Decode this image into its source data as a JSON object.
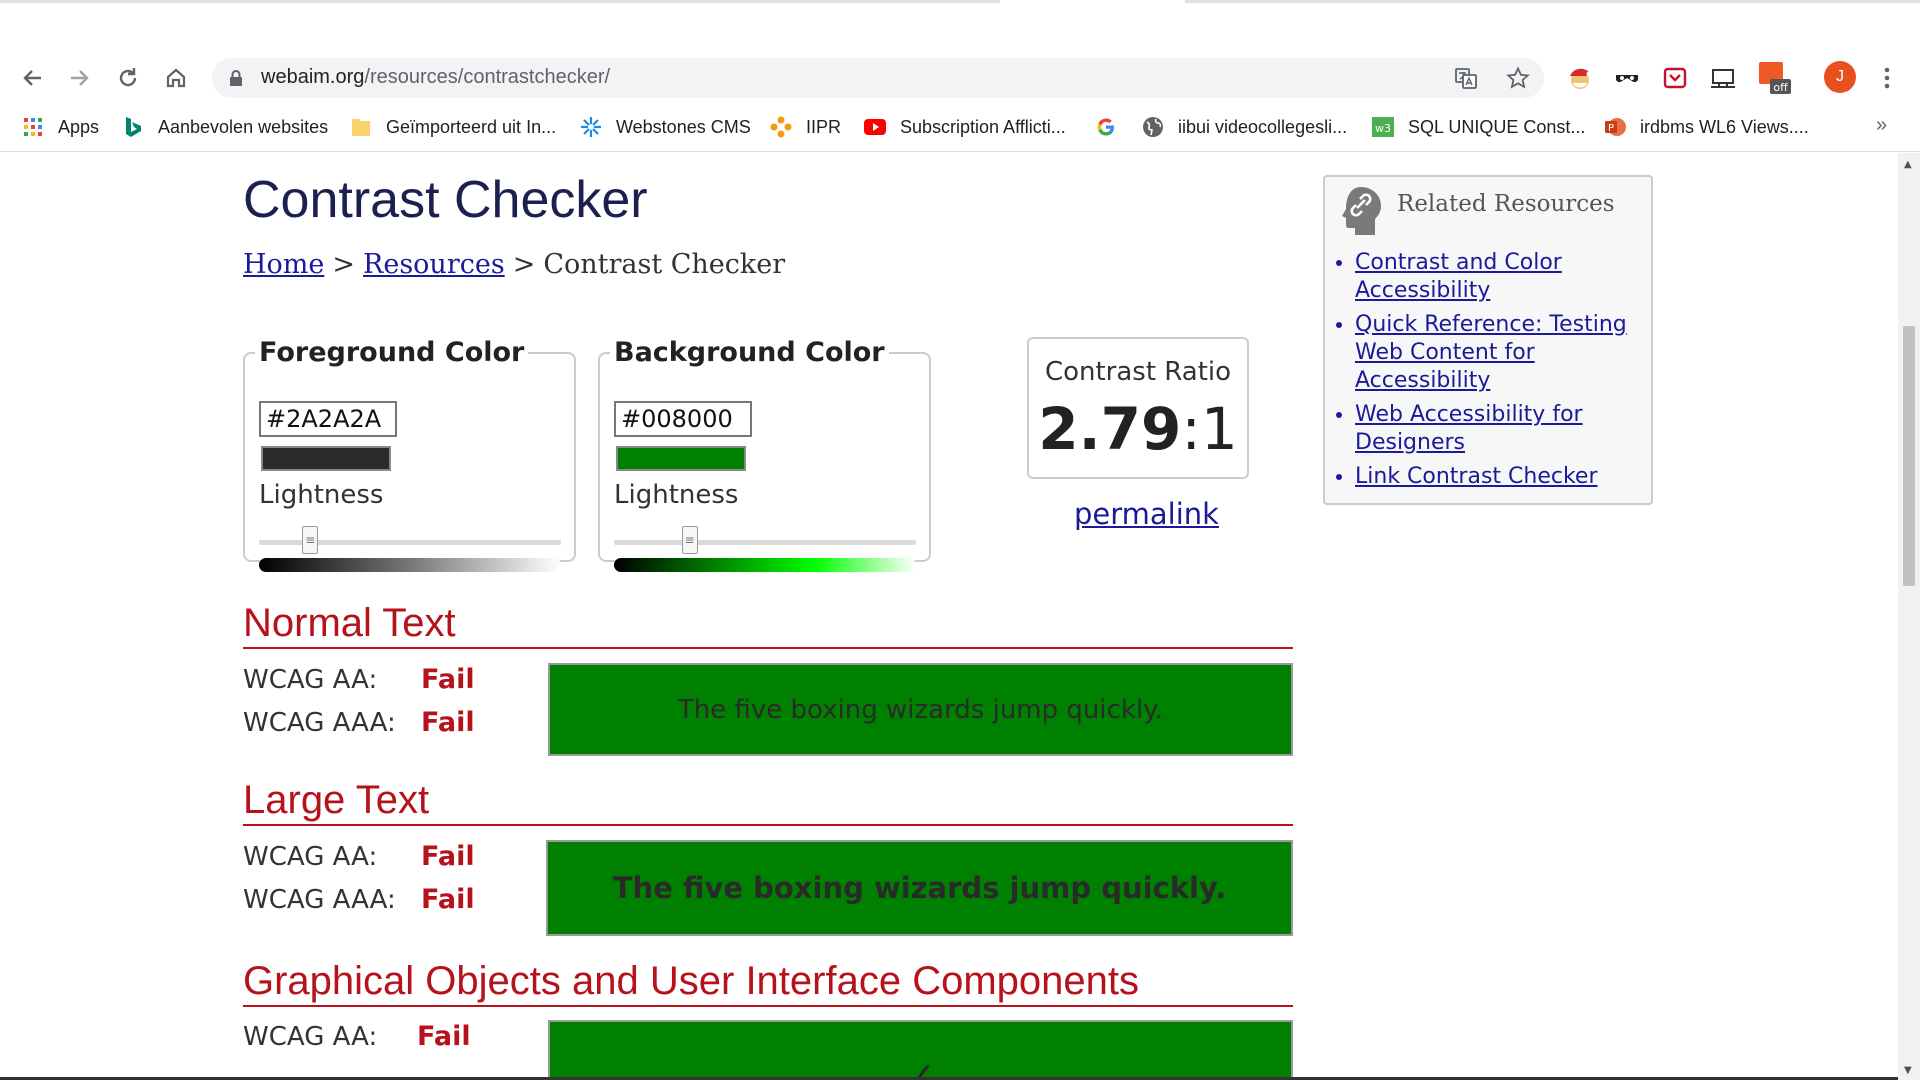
{
  "browser": {
    "url_host": "webaim.org",
    "url_path": "/resources/contrastchecker/",
    "avatar_letter": "J",
    "ext_badge": "off",
    "bookmarks_more": "»",
    "bookmarks": [
      {
        "label": "Apps",
        "icon": "apps-grid-icon"
      },
      {
        "label": "Aanbevolen websites",
        "icon": "bing-icon"
      },
      {
        "label": "Geïmporteerd uit In...",
        "icon": "folder-icon"
      },
      {
        "label": "Webstones CMS",
        "icon": "webstones-icon"
      },
      {
        "label": "IIPR",
        "icon": "iipr-icon"
      },
      {
        "label": "Subscription Afflicti...",
        "icon": "youtube-icon"
      },
      {
        "label": "",
        "icon": "google-icon"
      },
      {
        "label": "iibui videocollegesli...",
        "icon": "globe-icon"
      },
      {
        "label": "SQL UNIQUE Const...",
        "icon": "w3schools-icon"
      },
      {
        "label": "irdbms WL6 Views....",
        "icon": "powerpoint-icon"
      }
    ]
  },
  "page": {
    "title": "Contrast Checker",
    "breadcrumb": {
      "home": "Home",
      "resources": "Resources",
      "current": "Contrast Checker",
      "sep": ">"
    },
    "foreground": {
      "legend": "Foreground Color",
      "hex": "#2A2A2A",
      "swatch_color": "#2A2A2A",
      "lightness_label": "Lightness",
      "lightness": 0.17
    },
    "background": {
      "legend": "Background Color",
      "hex": "#008000",
      "swatch_color": "#008000",
      "lightness_label": "Lightness",
      "lightness": 0.25
    },
    "ratio": {
      "label": "Contrast Ratio",
      "value": "2.79",
      "suffix": ":1"
    },
    "permalink": "permalink",
    "related": {
      "heading": "Related Resources",
      "links": [
        "Contrast and Color Accessibility",
        "Quick Reference: Testing Web Content for Accessibility",
        "Web Accessibility for Designers",
        "Link Contrast Checker"
      ]
    },
    "normal_text": {
      "title": "Normal Text",
      "aa_label": "WCAG AA:",
      "aa_result": "Fail",
      "aaa_label": "WCAG AAA:",
      "aaa_result": "Fail",
      "sample": "The five boxing wizards jump quickly."
    },
    "large_text": {
      "title": "Large Text",
      "aa_label": "WCAG AA:",
      "aa_result": "Fail",
      "aaa_label": "WCAG AAA:",
      "aaa_result": "Fail",
      "sample": "The five boxing wizards jump quickly."
    },
    "graphical": {
      "title": "Graphical Objects and User Interface Components",
      "aa_label": "WCAG AA:",
      "aa_result": "Fail",
      "sample": "✓"
    }
  }
}
